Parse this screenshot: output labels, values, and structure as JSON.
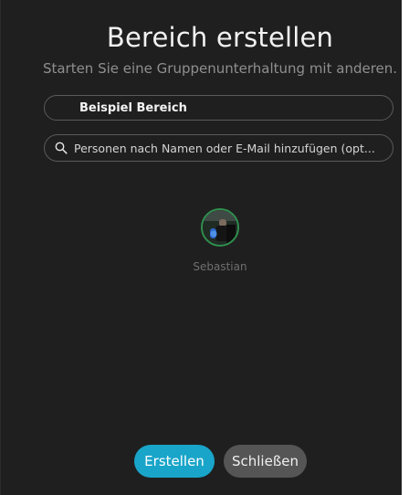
{
  "dialog": {
    "title": "Bereich erstellen",
    "subtitle": "Starten Sie eine Gruppenunterhaltung mit anderen."
  },
  "form": {
    "space_name_value": "Beispiel Bereich",
    "search_placeholder": "Personen nach Namen oder E-Mail hinzufügen (opt..."
  },
  "members": [
    {
      "name": "Sebastian",
      "icon": "avatar-photo",
      "status_color": "#2f8f4e"
    }
  ],
  "actions": {
    "create_label": "Erstellen",
    "close_label": "Schließen"
  },
  "colors": {
    "background": "#1f1f1f",
    "accent": "#19a5c9",
    "secondary_button": "#555555"
  },
  "icons": {
    "search": "search-icon"
  }
}
